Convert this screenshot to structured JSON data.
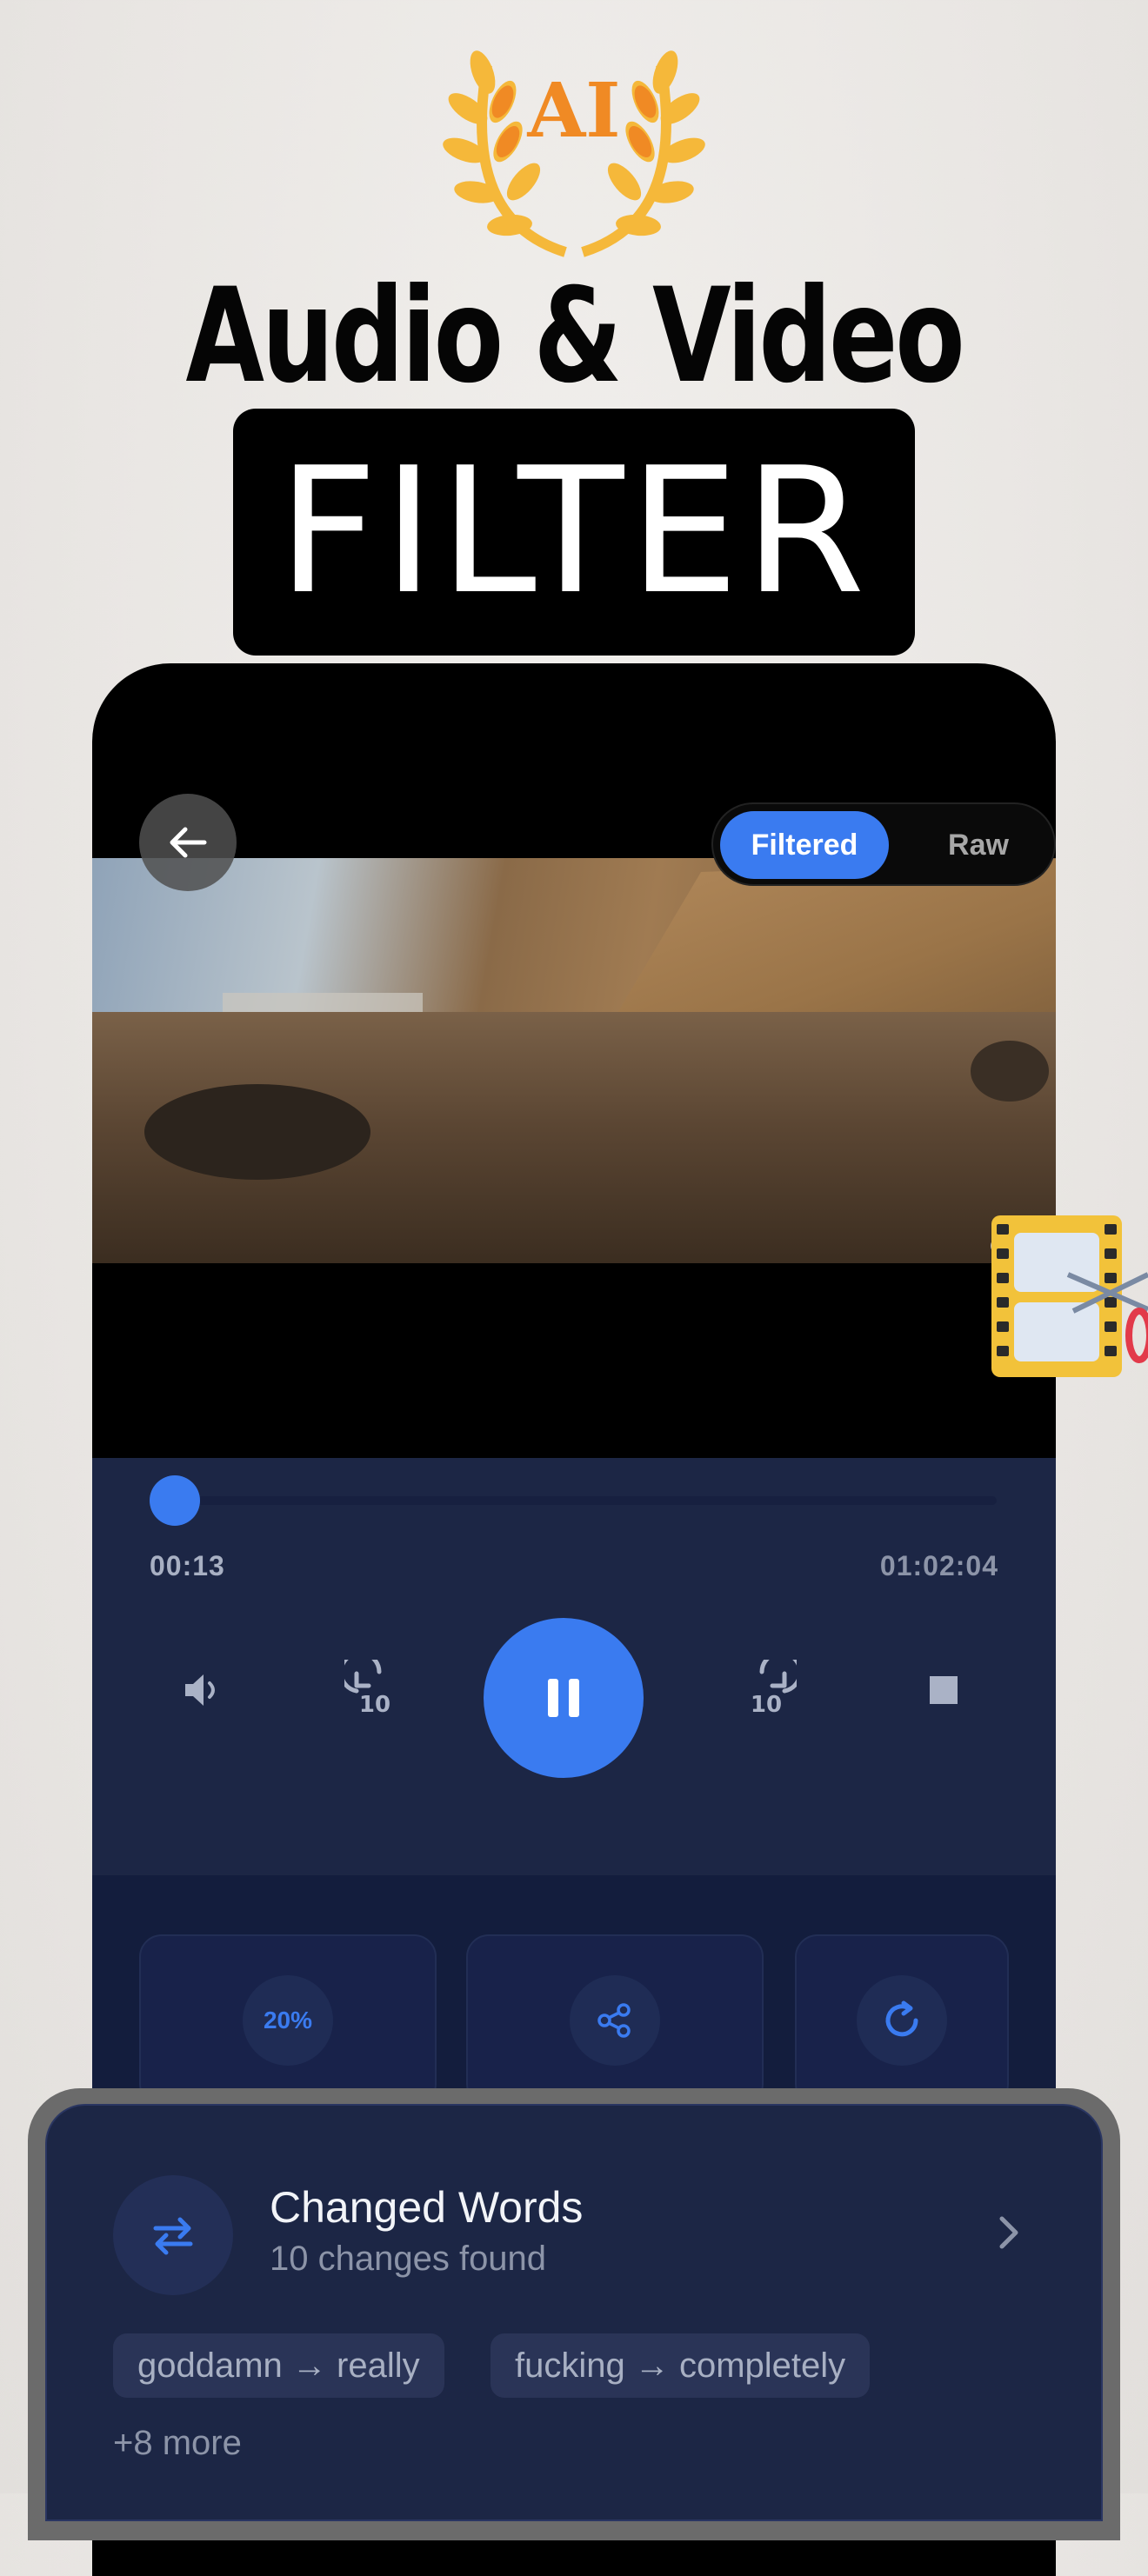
{
  "badge": {
    "text": "AI"
  },
  "headline": {
    "line1": "Audio & Video",
    "line2": "FILTER"
  },
  "header": {
    "toggle": {
      "active": "Filtered",
      "inactive": "Raw"
    }
  },
  "player": {
    "current_time": "00:13",
    "duration": "01:02:04",
    "progress_fraction": 0.0035
  },
  "actions": {
    "speed_label": "20%"
  },
  "sheet": {
    "title": "Changed Words",
    "subtitle": "10 changes found",
    "chips": [
      "goddamn → really",
      "fucking → completely"
    ],
    "more": "+8 more"
  },
  "colors": {
    "accent": "#3a7bf0",
    "panel": "#1c2645",
    "laurel": "#f5b83a",
    "ai_text": "#f08a24"
  }
}
